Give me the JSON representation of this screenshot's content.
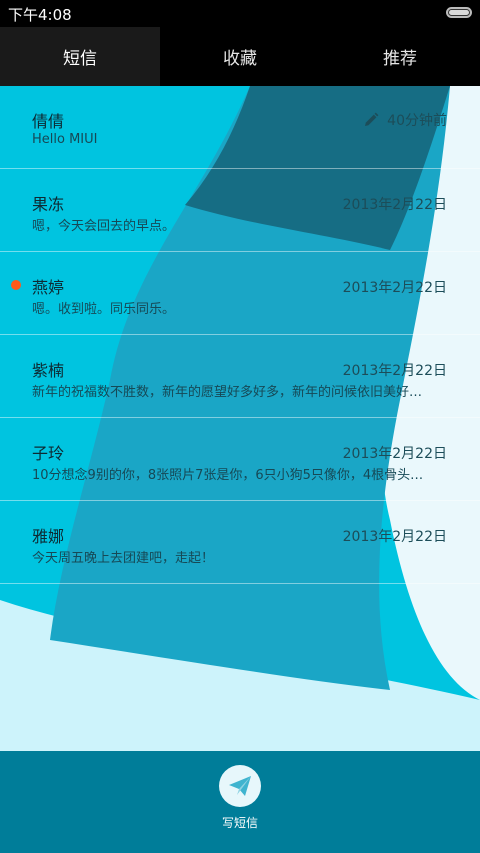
{
  "status_bar": {
    "time": "下午4:08"
  },
  "tabs": [
    {
      "label": "短信",
      "active": true
    },
    {
      "label": "收藏",
      "active": false
    },
    {
      "label": "推荐",
      "active": false
    }
  ],
  "messages": [
    {
      "name": "倩倩",
      "preview": "Hello MIUI",
      "date": "40分钟前",
      "draft_icon": "pencil-icon",
      "unread": false
    },
    {
      "name": "果冻",
      "preview": "嗯，今天会回去的早点。",
      "date": "2013年2月22日",
      "unread": false
    },
    {
      "name": "燕婷",
      "preview": "嗯。收到啦。同乐同乐。",
      "date": "2013年2月22日",
      "unread": true
    },
    {
      "name": "紫楠",
      "preview": "新年的祝福数不胜数，新年的愿望好多好多，新年的问候依旧美好…",
      "date": "2013年2月22日",
      "unread": false
    },
    {
      "name": "子玲",
      "preview": "10分想念9别的你，8张照片7张是你，6只小狗5只像你，4根骨头…",
      "date": "2013年2月22日",
      "unread": false
    },
    {
      "name": "雅娜",
      "preview": "今天周五晚上去团建吧，走起！",
      "date": "2013年2月22日",
      "unread": false
    }
  ],
  "bottom_bar": {
    "compose_label": "写短信",
    "compose_icon": "paper-plane-icon"
  },
  "colors": {
    "accent": "#007d99",
    "background_cyan": "#00c2de",
    "unread_dot": "#ff5a1a"
  }
}
